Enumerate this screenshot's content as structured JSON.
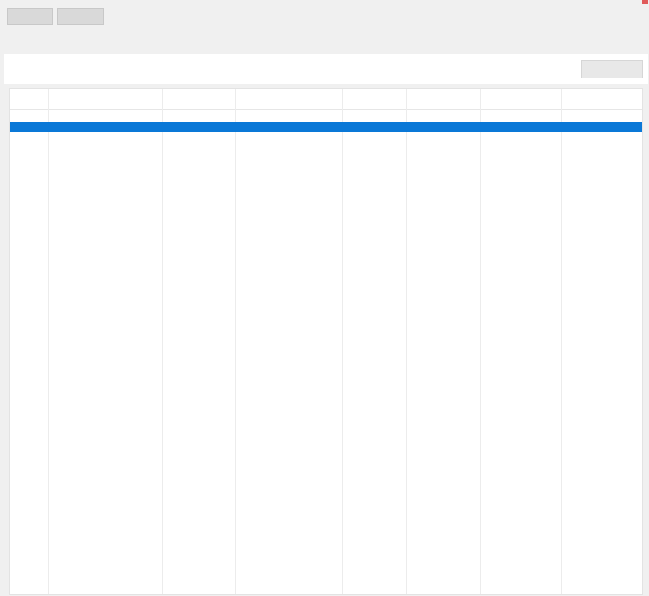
{
  "window": {
    "title": "",
    "close_color": "#e05a5a"
  },
  "toolbar": {
    "button1": "",
    "button2": "",
    "status": ""
  },
  "menu": {
    "items": [
      "",
      "",
      "",
      ""
    ]
  },
  "info": {
    "line1": "",
    "line2": "",
    "button": ""
  },
  "table": {
    "columns": [
      "",
      "",
      "",
      "",
      "",
      "",
      "",
      ""
    ],
    "selected_color": "#0a78d7",
    "link_color": "#7b7bf0",
    "rows": [
      {
        "kind": "plain",
        "cells": [
          "",
          "",
          "",
          "",
          "",
          "",
          "",
          ""
        ]
      },
      {
        "kind": "selected",
        "cells": [
          "",
          "",
          "",
          "",
          "",
          "",
          "",
          ""
        ]
      },
      {
        "kind": "plain",
        "cells": [
          "",
          "",
          "",
          "",
          "",
          "",
          "",
          ""
        ]
      },
      {
        "kind": "plain",
        "cells": [
          "",
          "",
          "",
          "",
          "",
          "",
          "",
          ""
        ]
      },
      {
        "kind": "plain",
        "cells": [
          "",
          "",
          "",
          "",
          "",
          "",
          "",
          ""
        ]
      },
      {
        "kind": "plain",
        "cells": [
          "",
          "",
          "",
          "",
          "",
          "",
          "",
          ""
        ]
      },
      {
        "kind": "data",
        "cells": [
          "",
          "",
          "",
          "",
          "",
          "",
          "",
          ""
        ]
      },
      {
        "kind": "data",
        "cells": [
          "",
          "",
          "",
          "",
          "",
          "",
          "",
          ""
        ]
      },
      {
        "kind": "data",
        "cells": [
          "",
          "",
          "",
          "",
          "",
          "",
          "",
          ""
        ]
      },
      {
        "kind": "data",
        "cells": [
          "",
          "",
          "",
          "",
          "",
          "",
          "",
          ""
        ]
      },
      {
        "kind": "plain",
        "cells": [
          "",
          "",
          "",
          "",
          "",
          "",
          "",
          ""
        ]
      },
      {
        "kind": "data",
        "cells": [
          "",
          "",
          "",
          "",
          "",
          "",
          "",
          ""
        ]
      },
      {
        "kind": "data",
        "cells": [
          "",
          "",
          "",
          "",
          "",
          "",
          "",
          ""
        ]
      },
      {
        "kind": "data",
        "cells": [
          "",
          "",
          "",
          "",
          "",
          "",
          "",
          ""
        ]
      },
      {
        "kind": "data",
        "cells": [
          "",
          "",
          "",
          "",
          "",
          "",
          "",
          ""
        ]
      },
      {
        "kind": "plain",
        "cells": [
          "",
          "",
          "",
          "",
          "",
          "",
          "",
          ""
        ]
      },
      {
        "kind": "data",
        "cells": [
          "",
          "",
          "",
          "",
          "",
          "",
          "",
          ""
        ]
      },
      {
        "kind": "plain",
        "cells": [
          "",
          "",
          "",
          "",
          "",
          "",
          "",
          ""
        ]
      },
      {
        "kind": "data",
        "cells": [
          "",
          "",
          "",
          "",
          "",
          "",
          "",
          ""
        ]
      },
      {
        "kind": "data",
        "cells": [
          "",
          "",
          "",
          "",
          "",
          "",
          "",
          ""
        ]
      },
      {
        "kind": "data",
        "cells": [
          "",
          "",
          "",
          "",
          "",
          "",
          "",
          ""
        ]
      },
      {
        "kind": "data",
        "cells": [
          "",
          "",
          "",
          "",
          "",
          "",
          "",
          ""
        ]
      },
      {
        "kind": "data",
        "cells": [
          "",
          "",
          "",
          "",
          "",
          "",
          "",
          ""
        ]
      },
      {
        "kind": "data",
        "cells": [
          "",
          "",
          "",
          "",
          "",
          "",
          "",
          ""
        ]
      },
      {
        "kind": "data",
        "cells": [
          "",
          "",
          "",
          "",
          "",
          "",
          "",
          ""
        ]
      },
      {
        "kind": "data",
        "cells": [
          "",
          "",
          "",
          "",
          "",
          "",
          "",
          ""
        ]
      },
      {
        "kind": "data",
        "cells": [
          "",
          "",
          "",
          "",
          "",
          "",
          "",
          ""
        ]
      },
      {
        "kind": "plain",
        "cells": [
          "",
          "",
          "",
          "",
          "",
          "",
          "",
          ""
        ]
      },
      {
        "kind": "data",
        "cells": [
          "",
          "",
          "",
          "",
          "",
          "",
          "",
          ""
        ]
      },
      {
        "kind": "plain",
        "cells": [
          "",
          "",
          "",
          "",
          "",
          "",
          "",
          ""
        ]
      },
      {
        "kind": "plain",
        "cells": [
          "",
          "",
          "",
          "",
          "",
          "",
          "",
          ""
        ]
      },
      {
        "kind": "data",
        "cells": [
          "",
          "",
          "",
          "",
          "",
          "",
          "",
          ""
        ]
      },
      {
        "kind": "data",
        "cells": [
          "",
          "",
          "",
          "",
          "",
          "",
          "",
          ""
        ]
      },
      {
        "kind": "data",
        "cells": [
          "",
          "",
          "",
          "",
          "",
          "",
          "",
          ""
        ]
      },
      {
        "kind": "data",
        "cells": [
          "",
          "",
          "",
          "",
          "",
          "",
          "",
          ""
        ]
      },
      {
        "kind": "data",
        "cells": [
          "",
          "",
          "",
          "",
          "",
          "",
          "",
          ""
        ]
      },
      {
        "kind": "data",
        "cells": [
          "",
          "",
          "",
          "",
          "",
          "",
          "",
          ""
        ]
      }
    ]
  }
}
